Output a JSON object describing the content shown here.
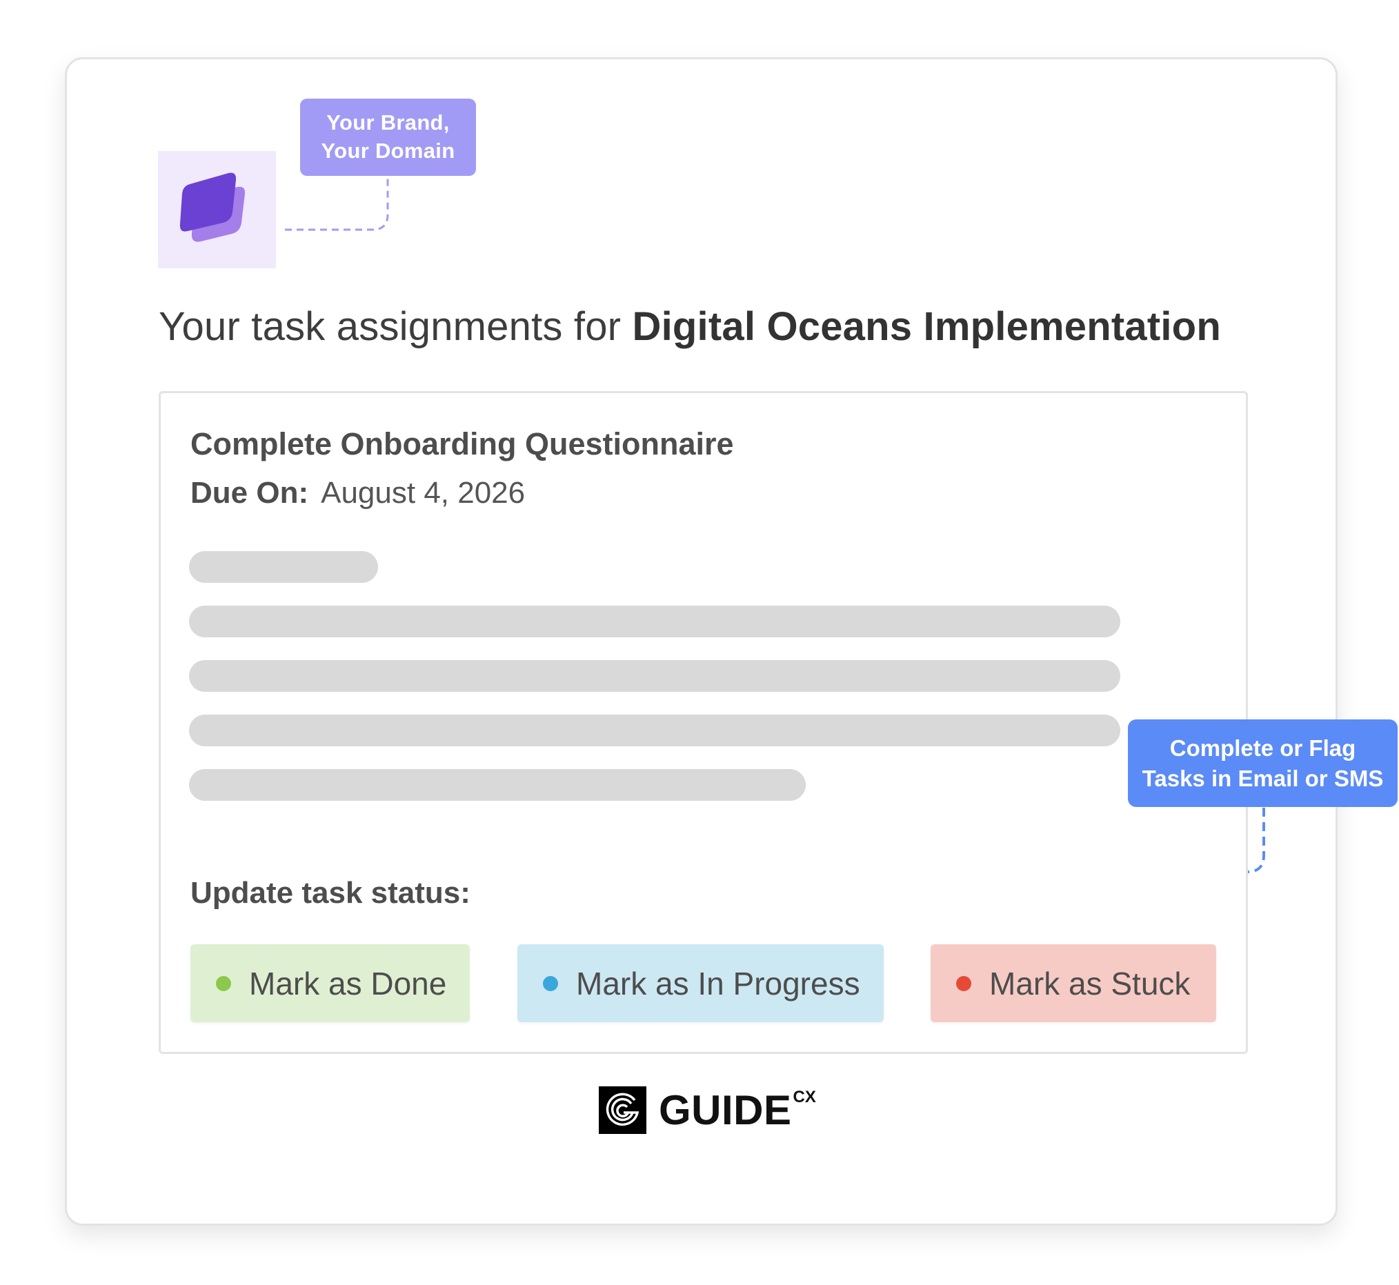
{
  "brand_callout": {
    "lines": [
      "Your Brand,",
      "Your Domain"
    ]
  },
  "email_callout": {
    "lines": [
      "Complete or Flag",
      "Tasks in Email or SMS"
    ]
  },
  "page_title": {
    "prefix": "Your task assignments for",
    "project": "Digital Oceans Implementation"
  },
  "task": {
    "name": "Complete Onboarding Questionnaire",
    "due_label": "Due On:",
    "due_date": "August 4, 2026"
  },
  "status": {
    "heading": "Update task status:",
    "buttons": [
      {
        "label": "Mark as Done",
        "dot_color": "#8cc84b",
        "bg_color": "#dff0d2"
      },
      {
        "label": "Mark as In Progress",
        "dot_color": "#3aa7dc",
        "bg_color": "#cce8f3"
      },
      {
        "label": "Mark as Stuck",
        "dot_color": "#e64a36",
        "bg_color": "#f7cbc5"
      }
    ]
  },
  "footer": {
    "logo_text": "GUIDE",
    "logo_superscript": "CX"
  },
  "colors": {
    "brand_callout": "#a29bf5",
    "email_callout": "#5b8bf7",
    "logo_tile": "#f1e9fc",
    "skeleton": "#d9d9d9"
  },
  "icons": {
    "brand_logo": "stacked-purple-cards-icon",
    "footer_mark": "guide-cx-logo-icon"
  }
}
